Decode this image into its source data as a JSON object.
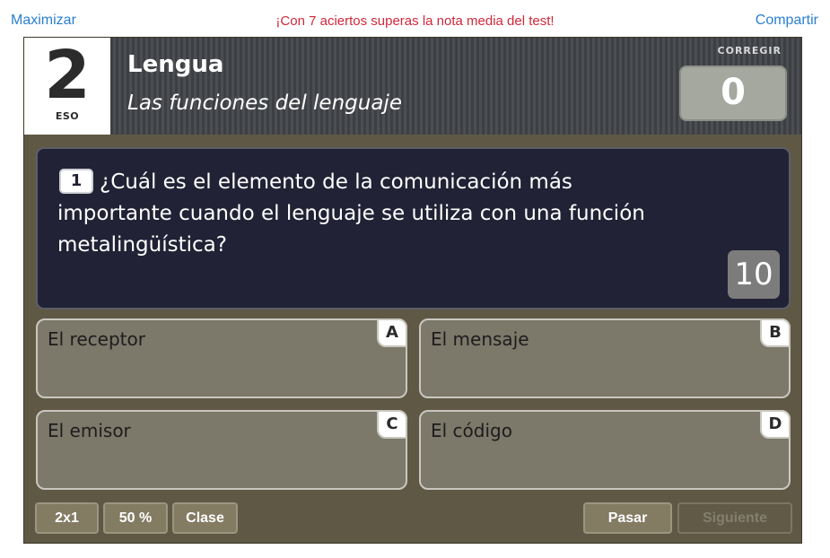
{
  "topbar": {
    "maximize": "Maximizar",
    "promo": "¡Con 7 aciertos superas la nota media del test!",
    "share": "Compartir"
  },
  "header": {
    "grade_number": "2",
    "grade_label": "ESO",
    "subject": "Lengua",
    "topic": "Las funciones del lenguaje",
    "correct_label": "CORREGIR",
    "score": "0"
  },
  "question": {
    "number": "1",
    "text": "¿Cuál es el elemento de la comunicación más importante cuando el lenguaje se utiliza con una función metalingüística?",
    "timer": "10"
  },
  "answers": [
    {
      "letter": "A",
      "text": "El receptor"
    },
    {
      "letter": "B",
      "text": "El mensaje"
    },
    {
      "letter": "C",
      "text": "El emisor"
    },
    {
      "letter": "D",
      "text": "El código"
    }
  ],
  "buttons": {
    "two_for_one": "2x1",
    "fifty": "50 %",
    "class": "Clase",
    "skip": "Pasar",
    "next": "Siguiente"
  },
  "colors": {
    "link": "#2a7fd0",
    "promo": "#d0283a",
    "frame": "#5f5844",
    "question_bg": "#212235",
    "answer_bg": "#7c786a",
    "score_box": "#a4a89e"
  }
}
